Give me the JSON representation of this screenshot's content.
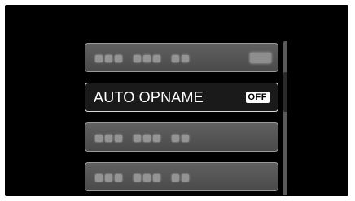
{
  "menu": {
    "items": [
      {
        "label": "",
        "blurred": true,
        "value_blurred": true
      },
      {
        "label": "AUTO OPNAME",
        "value": "OFF",
        "selected": true
      },
      {
        "label": "",
        "blurred": true
      },
      {
        "label": "",
        "blurred": true
      }
    ]
  },
  "scrollbar": {
    "position_fraction": 0.27
  }
}
